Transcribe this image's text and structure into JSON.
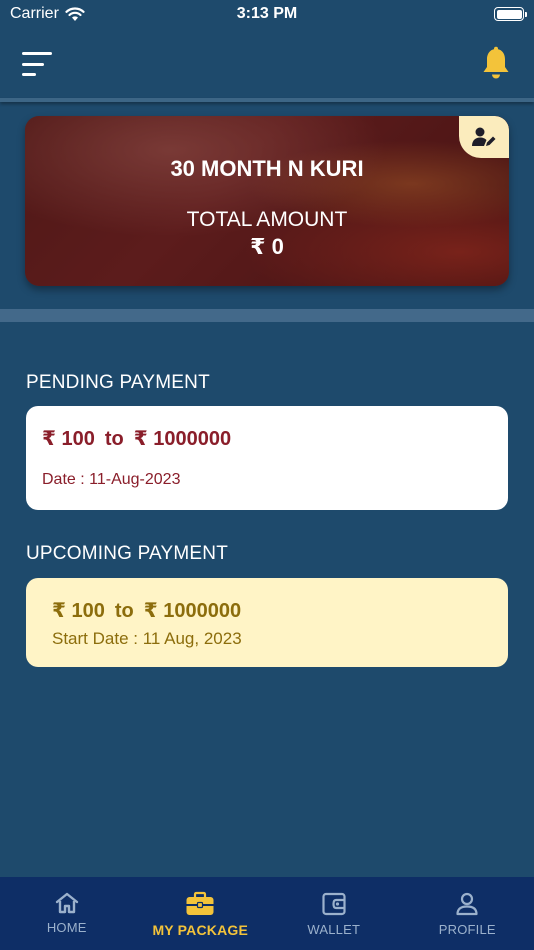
{
  "status_bar": {
    "carrier": "Carrier",
    "time": "3:13 PM"
  },
  "package": {
    "title": "30 MONTH N KURI",
    "total_label": "TOTAL AMOUNT",
    "total_value": "₹ 0"
  },
  "pending": {
    "title": "PENDING PAYMENT",
    "from": "₹ 100",
    "to_word": "to",
    "to": "₹ 1000000",
    "date": "Date : 11-Aug-2023"
  },
  "upcoming": {
    "title": "UPCOMING PAYMENT",
    "from": "₹ 100",
    "to_word": "to",
    "to": "₹ 1000000",
    "date": "Start Date : 11  Aug, 2023"
  },
  "tabs": [
    {
      "label": "HOME",
      "icon": "home-icon"
    },
    {
      "label": "MY PACKAGE",
      "icon": "briefcase-icon",
      "active": true
    },
    {
      "label": "WALLET",
      "icon": "wallet-icon"
    },
    {
      "label": "PROFILE",
      "icon": "person-icon"
    }
  ],
  "colors": {
    "background": "#1e4a6c",
    "tab_bar": "#0e2e66",
    "active_tab": "#f3c33a",
    "pending_text": "#8a1e2a",
    "upcoming_card": "#fff4c6",
    "upcoming_text": "#8c6d0c"
  }
}
